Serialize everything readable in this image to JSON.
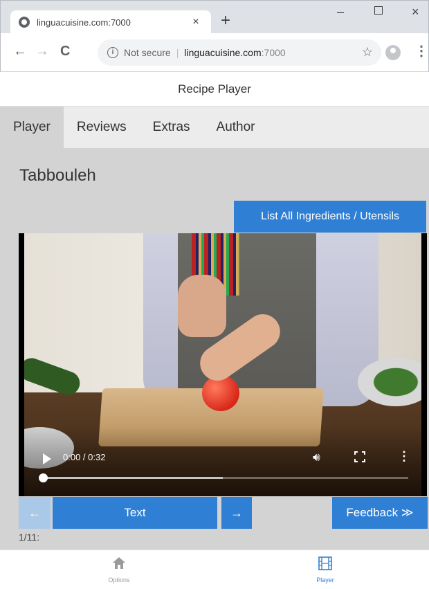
{
  "browser": {
    "tab_title": "linguacuisine.com:7000",
    "tab_close": "×",
    "new_tab": "+",
    "minimize": "–",
    "close": "×",
    "back": "←",
    "forward": "→",
    "reload": "C",
    "security_text": "Not secure",
    "separator": "|",
    "url_host": "linguacuisine.com",
    "url_port": ":7000",
    "bookmark": "☆",
    "menu": "⋮"
  },
  "app": {
    "header_title": "Recipe Player",
    "tabs": [
      {
        "label": "Player",
        "active": true
      },
      {
        "label": "Reviews",
        "active": false
      },
      {
        "label": "Extras",
        "active": false
      },
      {
        "label": "Author",
        "active": false
      }
    ],
    "recipe_title": "Tabbouleh",
    "ingredients_button": "List All Ingredients / Utensils",
    "video": {
      "time": "0:00 / 0:32",
      "progress": 0,
      "volume_icon": "volume-icon",
      "more": "⋮"
    },
    "prev_label": "←",
    "text_button": "Text",
    "next_label": "→",
    "feedback_button": "Feedback ≫",
    "step_counter": "1/11:"
  },
  "bottom_nav": {
    "options_label": "Options",
    "player_label": "Player"
  },
  "colors": {
    "accent": "#2f7fd4",
    "accent_disabled": "#aac8e8",
    "content_bg": "#d3d3d3"
  }
}
